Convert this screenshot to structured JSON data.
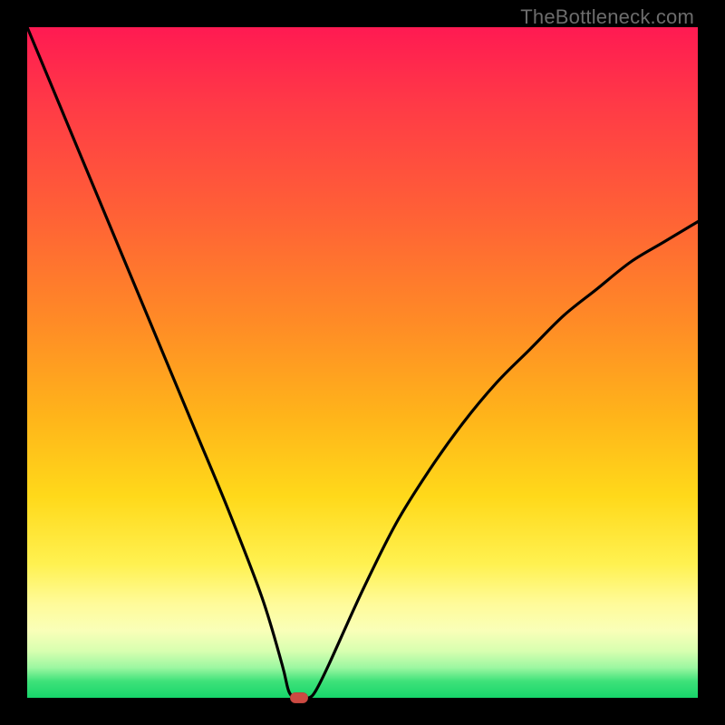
{
  "watermark": "TheBottleneck.com",
  "chart_data": {
    "type": "line",
    "title": "",
    "xlabel": "",
    "ylabel": "",
    "xlim": [
      0,
      100
    ],
    "ylim": [
      0,
      100
    ],
    "grid": false,
    "series": [
      {
        "name": "curve",
        "x": [
          0,
          5,
          10,
          15,
          20,
          25,
          30,
          35,
          38,
          39,
          40,
          41,
          42,
          43,
          45,
          50,
          55,
          60,
          65,
          70,
          75,
          80,
          85,
          90,
          95,
          100
        ],
        "values": [
          100,
          88,
          76,
          64,
          52,
          40,
          28,
          15,
          5,
          1,
          0,
          0,
          0,
          1,
          5,
          16,
          26,
          34,
          41,
          47,
          52,
          57,
          61,
          65,
          68,
          71
        ]
      }
    ],
    "marker": {
      "x": 40.5,
      "y": 0
    },
    "colors": {
      "curve": "#000000",
      "marker": "#cc4a42",
      "gradient_top": "#ff1a52",
      "gradient_bottom": "#17d56a"
    }
  }
}
